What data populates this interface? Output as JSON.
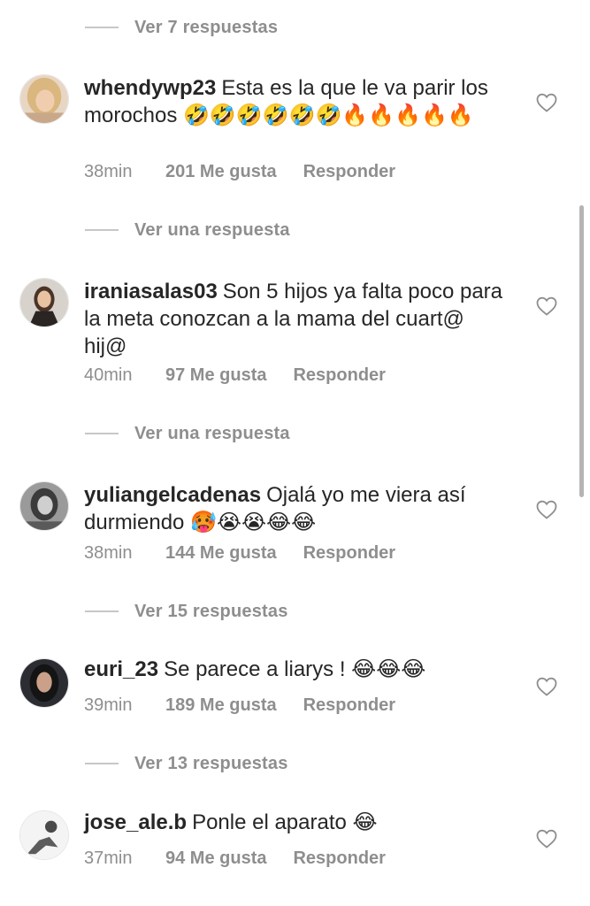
{
  "threads": [
    {
      "replies_label": "Ver 7 respuestas"
    },
    {
      "username": "whendywp23",
      "text": "Esta es la que le va parir los morochos 🤣🤣🤣🤣🤣🤣🔥🔥🔥🔥🔥",
      "time": "38min",
      "likes": "201 Me gusta",
      "reply": "Responder",
      "replies_label": "Ver una respuesta"
    },
    {
      "username": "iraniasalas03",
      "text": "Son 5 hijos ya falta poco para la meta conozcan  a la mama del cuart@ hij@",
      "time": "40min",
      "likes": "97 Me gusta",
      "reply": "Responder",
      "replies_label": "Ver una respuesta"
    },
    {
      "username": "yuliangelcadenas",
      "text": "Ojalá yo me viera así durmiendo 🥵😭😭😂😂",
      "time": "38min",
      "likes": "144 Me gusta",
      "reply": "Responder",
      "replies_label": "Ver 15 respuestas"
    },
    {
      "username": "euri_23",
      "text": "Se parece a liarys ! 😂😂😂",
      "time": "39min",
      "likes": "189 Me gusta",
      "reply": "Responder",
      "replies_label": "Ver 13 respuestas"
    },
    {
      "username": "jose_ale.b",
      "text": "Ponle el aparato 😂",
      "time": "37min",
      "likes": "94 Me gusta",
      "reply": "Responder"
    }
  ],
  "icons": {
    "like": "heart-outline-icon"
  },
  "colors": {
    "text": "#262626",
    "secondary": "#8e8e8e",
    "background": "#ffffff"
  }
}
